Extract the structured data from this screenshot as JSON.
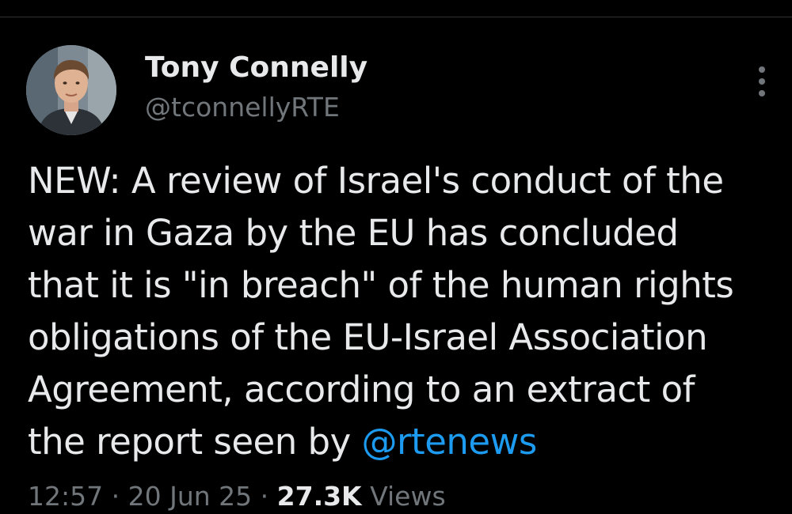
{
  "author": {
    "display_name": "Tony Connelly",
    "handle": "@tconnellyRTE"
  },
  "tweet": {
    "lines": [
      "NEW: A review of Israel's conduct of the",
      "war in Gaza by the EU has concluded",
      "that it is \"in breach\" of the human rights",
      "obligations of the EU-Israel Association",
      "Agreement, according to an extract of",
      "the report seen by "
    ],
    "mention": "@rtenews"
  },
  "meta": {
    "time": "12:57",
    "date": "20 Jun 25",
    "separator": "·",
    "views_count": "27.3K",
    "views_label": "Views"
  },
  "icons": {
    "more": "more-vertical-icon"
  },
  "colors": {
    "background": "#000000",
    "text": "#e7e9ea",
    "secondary": "#71767b",
    "link": "#1d9bf0"
  }
}
